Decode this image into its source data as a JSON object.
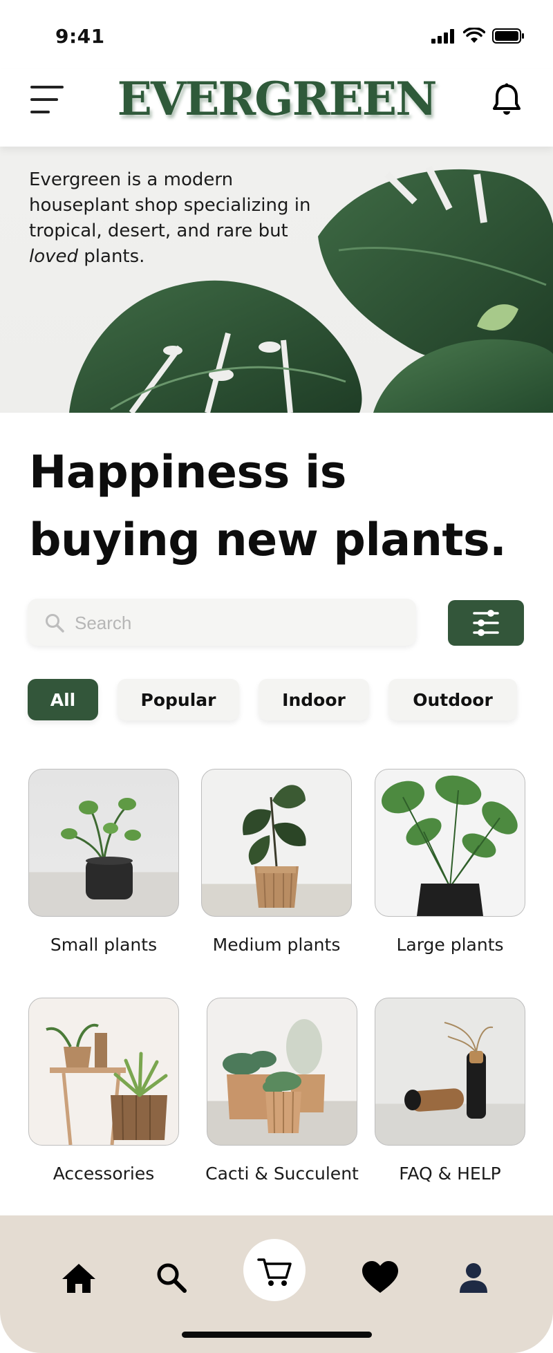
{
  "status_bar": {
    "time": "9:41"
  },
  "header": {
    "logo": "EVERGREEN"
  },
  "hero": {
    "text_before": "Evergreen is a modern houseplant shop specializing in tropical, desert, and rare but ",
    "text_emphasis": "loved",
    "text_after": " plants."
  },
  "headline": "Happiness is buying new plants.",
  "search": {
    "placeholder": "Search"
  },
  "filters": [
    {
      "label": "All",
      "active": true
    },
    {
      "label": "Popular",
      "active": false
    },
    {
      "label": "Indoor",
      "active": false
    },
    {
      "label": "Outdoor",
      "active": false
    }
  ],
  "categories": [
    {
      "label": "Small plants"
    },
    {
      "label": "Medium plants"
    },
    {
      "label": "Large plants"
    },
    {
      "label": "Accessories"
    },
    {
      "label": "Cacti & Succulent"
    },
    {
      "label": "FAQ & HELP"
    }
  ],
  "bottom_nav": [
    "home-icon",
    "search-icon",
    "cart-icon",
    "heart-icon",
    "profile-icon"
  ],
  "colors": {
    "brand_green": "#33563a",
    "logo_green": "#2f5a3a",
    "nav_bg": "#e4dcd2"
  }
}
